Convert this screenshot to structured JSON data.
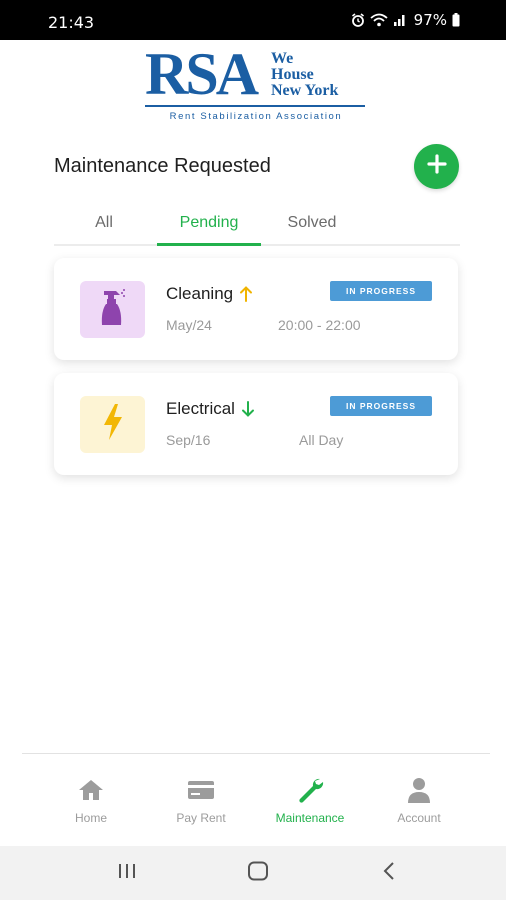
{
  "status_bar": {
    "time": "21:43",
    "battery": "97%"
  },
  "logo": {
    "main": "RSA",
    "words": [
      "We",
      "House",
      "New York"
    ],
    "subtitle": "Rent Stabilization Association"
  },
  "page": {
    "title": "Maintenance Requested"
  },
  "tabs": [
    {
      "label": "All",
      "active": false
    },
    {
      "label": "Pending",
      "active": true
    },
    {
      "label": "Solved",
      "active": false
    }
  ],
  "requests": [
    {
      "title": "Cleaning",
      "icon": "spray-bottle-icon",
      "priority": "arrow-up-icon",
      "status": "IN PROGRESS",
      "date": "May/24",
      "time": "20:00 - 22:00"
    },
    {
      "title": "Electrical",
      "icon": "lightning-bolt-icon",
      "priority": "arrow-down-icon",
      "status": "IN PROGRESS",
      "date": "Sep/16",
      "time": "All Day"
    }
  ],
  "bottom_nav": [
    {
      "label": "Home",
      "icon": "home-icon",
      "active": false
    },
    {
      "label": "Pay Rent",
      "icon": "credit-card-icon",
      "active": false
    },
    {
      "label": "Maintenance",
      "icon": "wrench-icon",
      "active": true
    },
    {
      "label": "Account",
      "icon": "person-icon",
      "active": false
    }
  ],
  "colors": {
    "accent": "#22b14c",
    "brand": "#1b5ea3",
    "badge": "#4d9bd6",
    "priority_up": "#f0b400",
    "priority_down": "#22b14c"
  }
}
